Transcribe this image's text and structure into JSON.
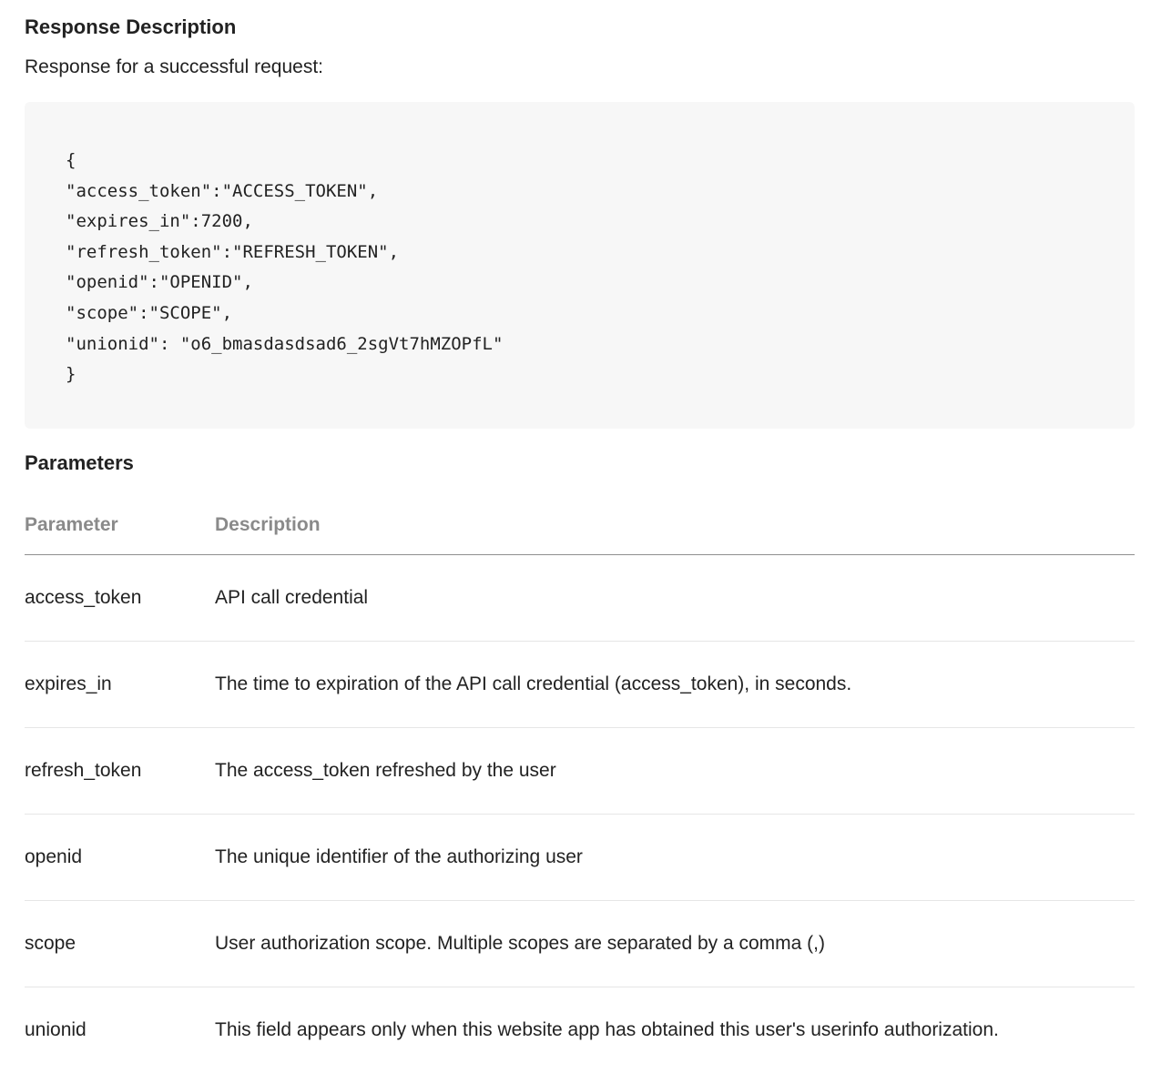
{
  "response": {
    "title": "Response Description",
    "intro": "Response for a successful request:",
    "code_lines": [
      "{",
      "\"access_token\":\"ACCESS_TOKEN\",",
      "\"expires_in\":7200,",
      "\"refresh_token\":\"REFRESH_TOKEN\",",
      "\"openid\":\"OPENID\",",
      "\"scope\":\"SCOPE\",",
      "\"unionid\": \"o6_bmasdasdsad6_2sgVt7hMZOPfL\"",
      "}"
    ]
  },
  "parameters": {
    "title": "Parameters",
    "columns": [
      "Parameter",
      "Description"
    ],
    "rows": [
      {
        "name": "access_token",
        "description": "API call credential"
      },
      {
        "name": "expires_in",
        "description": "The time to expiration of the API call credential (access_token), in seconds."
      },
      {
        "name": "refresh_token",
        "description": "The access_token refreshed by the user"
      },
      {
        "name": "openid",
        "description": "The unique identifier of the authorizing user"
      },
      {
        "name": "scope",
        "description": "User authorization scope. Multiple scopes are separated by a comma (,)"
      },
      {
        "name": "unionid",
        "description": "This field appears only when this website app has obtained this user's userinfo authorization."
      }
    ]
  }
}
